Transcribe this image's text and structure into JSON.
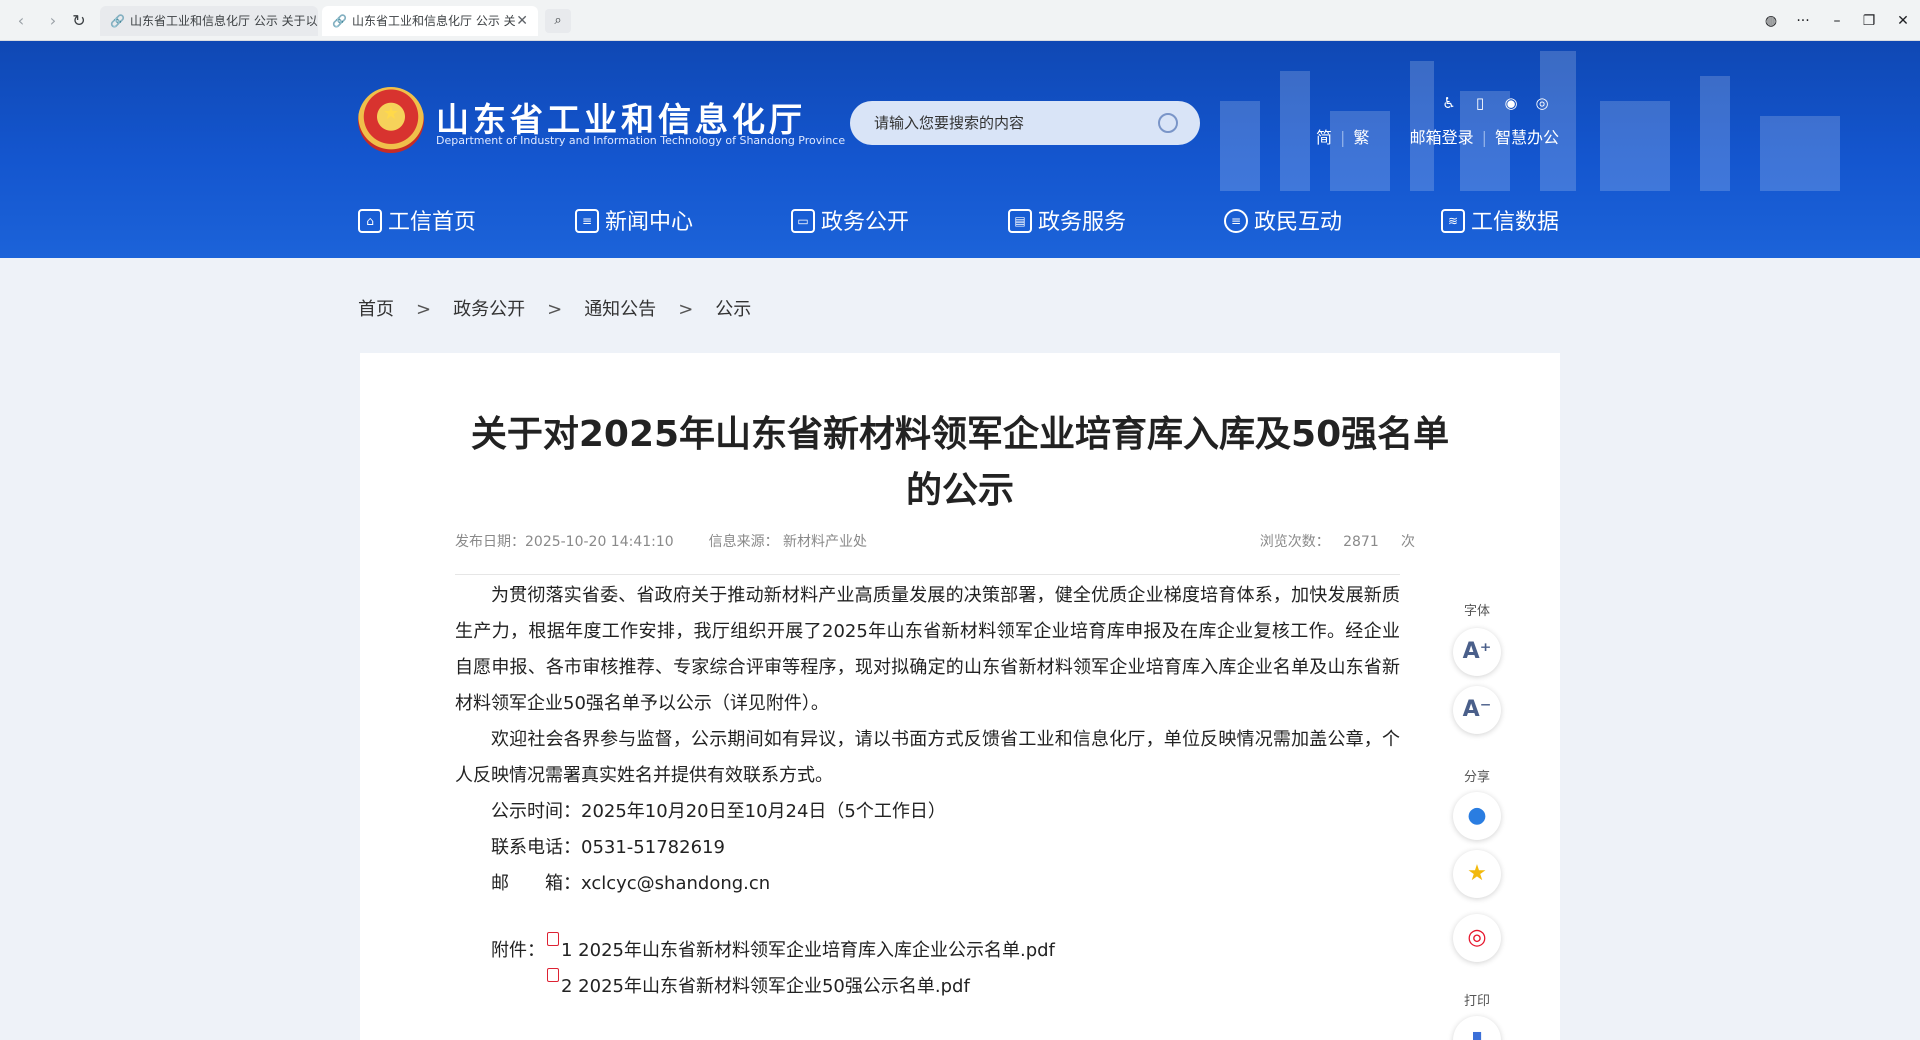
{
  "browser": {
    "tabs": [
      {
        "title": "山东省工业和信息化厅 公示 关于以"
      },
      {
        "title": "山东省工业和信息化厅 公示 关"
      }
    ],
    "controls": {
      "minimize": "–",
      "restore": "❐",
      "close": "✕",
      "more": "···"
    }
  },
  "header": {
    "title": "山东省工业和信息化厅",
    "subtitle": "Department of Industry and Information Technology of Shandong Province",
    "search_placeholder": "请输入您要搜索的内容",
    "links": {
      "simplified": "简",
      "traditional": "繁",
      "mail": "邮箱登录",
      "office": "智慧办公"
    },
    "icons": [
      "accessibility-icon",
      "mobile-icon",
      "wechat-icon",
      "weibo-icon"
    ]
  },
  "menu": [
    {
      "label": "工信首页"
    },
    {
      "label": "新闻中心"
    },
    {
      "label": "政务公开"
    },
    {
      "label": "政务服务"
    },
    {
      "label": "政民互动"
    },
    {
      "label": "工信数据"
    }
  ],
  "breadcrumb": [
    "首页",
    "政务公开",
    "通知公告",
    "公示"
  ],
  "article": {
    "title": "关于对2025年山东省新材料领军企业培育库入库及50强名单的公示",
    "publish_date": "发布日期：2025-10-20 14:41:10",
    "source": "信息来源：  新材料产业处",
    "views_label": "浏览次数：",
    "views_count": "2871",
    "views_unit": "次",
    "paragraph1": "为贯彻落实省委、省政府关于推动新材料产业高质量发展的决策部署，健全优质企业梯度培育体系，加快发展新质生产力，根据年度工作安排，我厅组织开展了2025年山东省新材料领军企业培育库申报及在库企业复核工作。经企业自愿申报、各市审核推荐、专家综合评审等程序，现对拟确定的山东省新材料领军企业培育库入库企业名单及山东省新材料领军企业50强名单予以公示（详见附件）。",
    "paragraph2": "欢迎社会各界参与监督，公示期间如有异议，请以书面方式反馈省工业和信息化厅，单位反映情况需加盖公章，个人反映情况需署真实姓名并提供有效联系方式。",
    "period": "公示时间：2025年10月20日至10月24日（5个工作日）",
    "phone": "联系电话：0531-51782619",
    "email": "邮　　箱：xclcyc@shandong.cn",
    "attach_label": "附件：",
    "attachments": [
      "1 2025年山东省新材料领军企业培育库入库企业公示名单.pdf",
      "2 2025年山东省新材料领军企业50强公示名单.pdf"
    ]
  },
  "side": {
    "font_label": "字体",
    "font_up": "A⁺",
    "font_down": "A⁻",
    "share_label": "分享",
    "print_label": "打印"
  }
}
